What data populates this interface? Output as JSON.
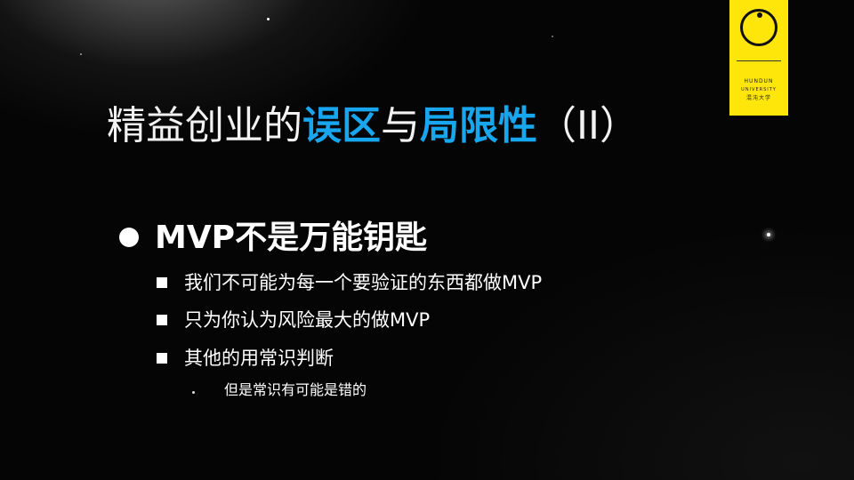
{
  "slide": {
    "title_parts": [
      {
        "text": "精益创业的",
        "highlight": false
      },
      {
        "text": "误区",
        "highlight": true
      },
      {
        "text": "与",
        "highlight": false
      },
      {
        "text": "局限性",
        "highlight": true
      },
      {
        "text": "（II）",
        "highlight": false
      }
    ],
    "bullet": "MVP不是万能钥匙",
    "sub_bullets": [
      "我们不可能为每一个要验证的东西都做MVP",
      "只为你认为风险最大的做MVP",
      "其他的用常识判断"
    ],
    "sub_sub_bullet": "但是常识有可能是错的"
  },
  "logo": {
    "line1": "HUNDUN",
    "line2": "UNIVERSITY",
    "line3": "混沌大学"
  },
  "colors": {
    "highlight": "#18a6ee",
    "logo_bg": "#ffe60a",
    "text": "#ffffff"
  }
}
